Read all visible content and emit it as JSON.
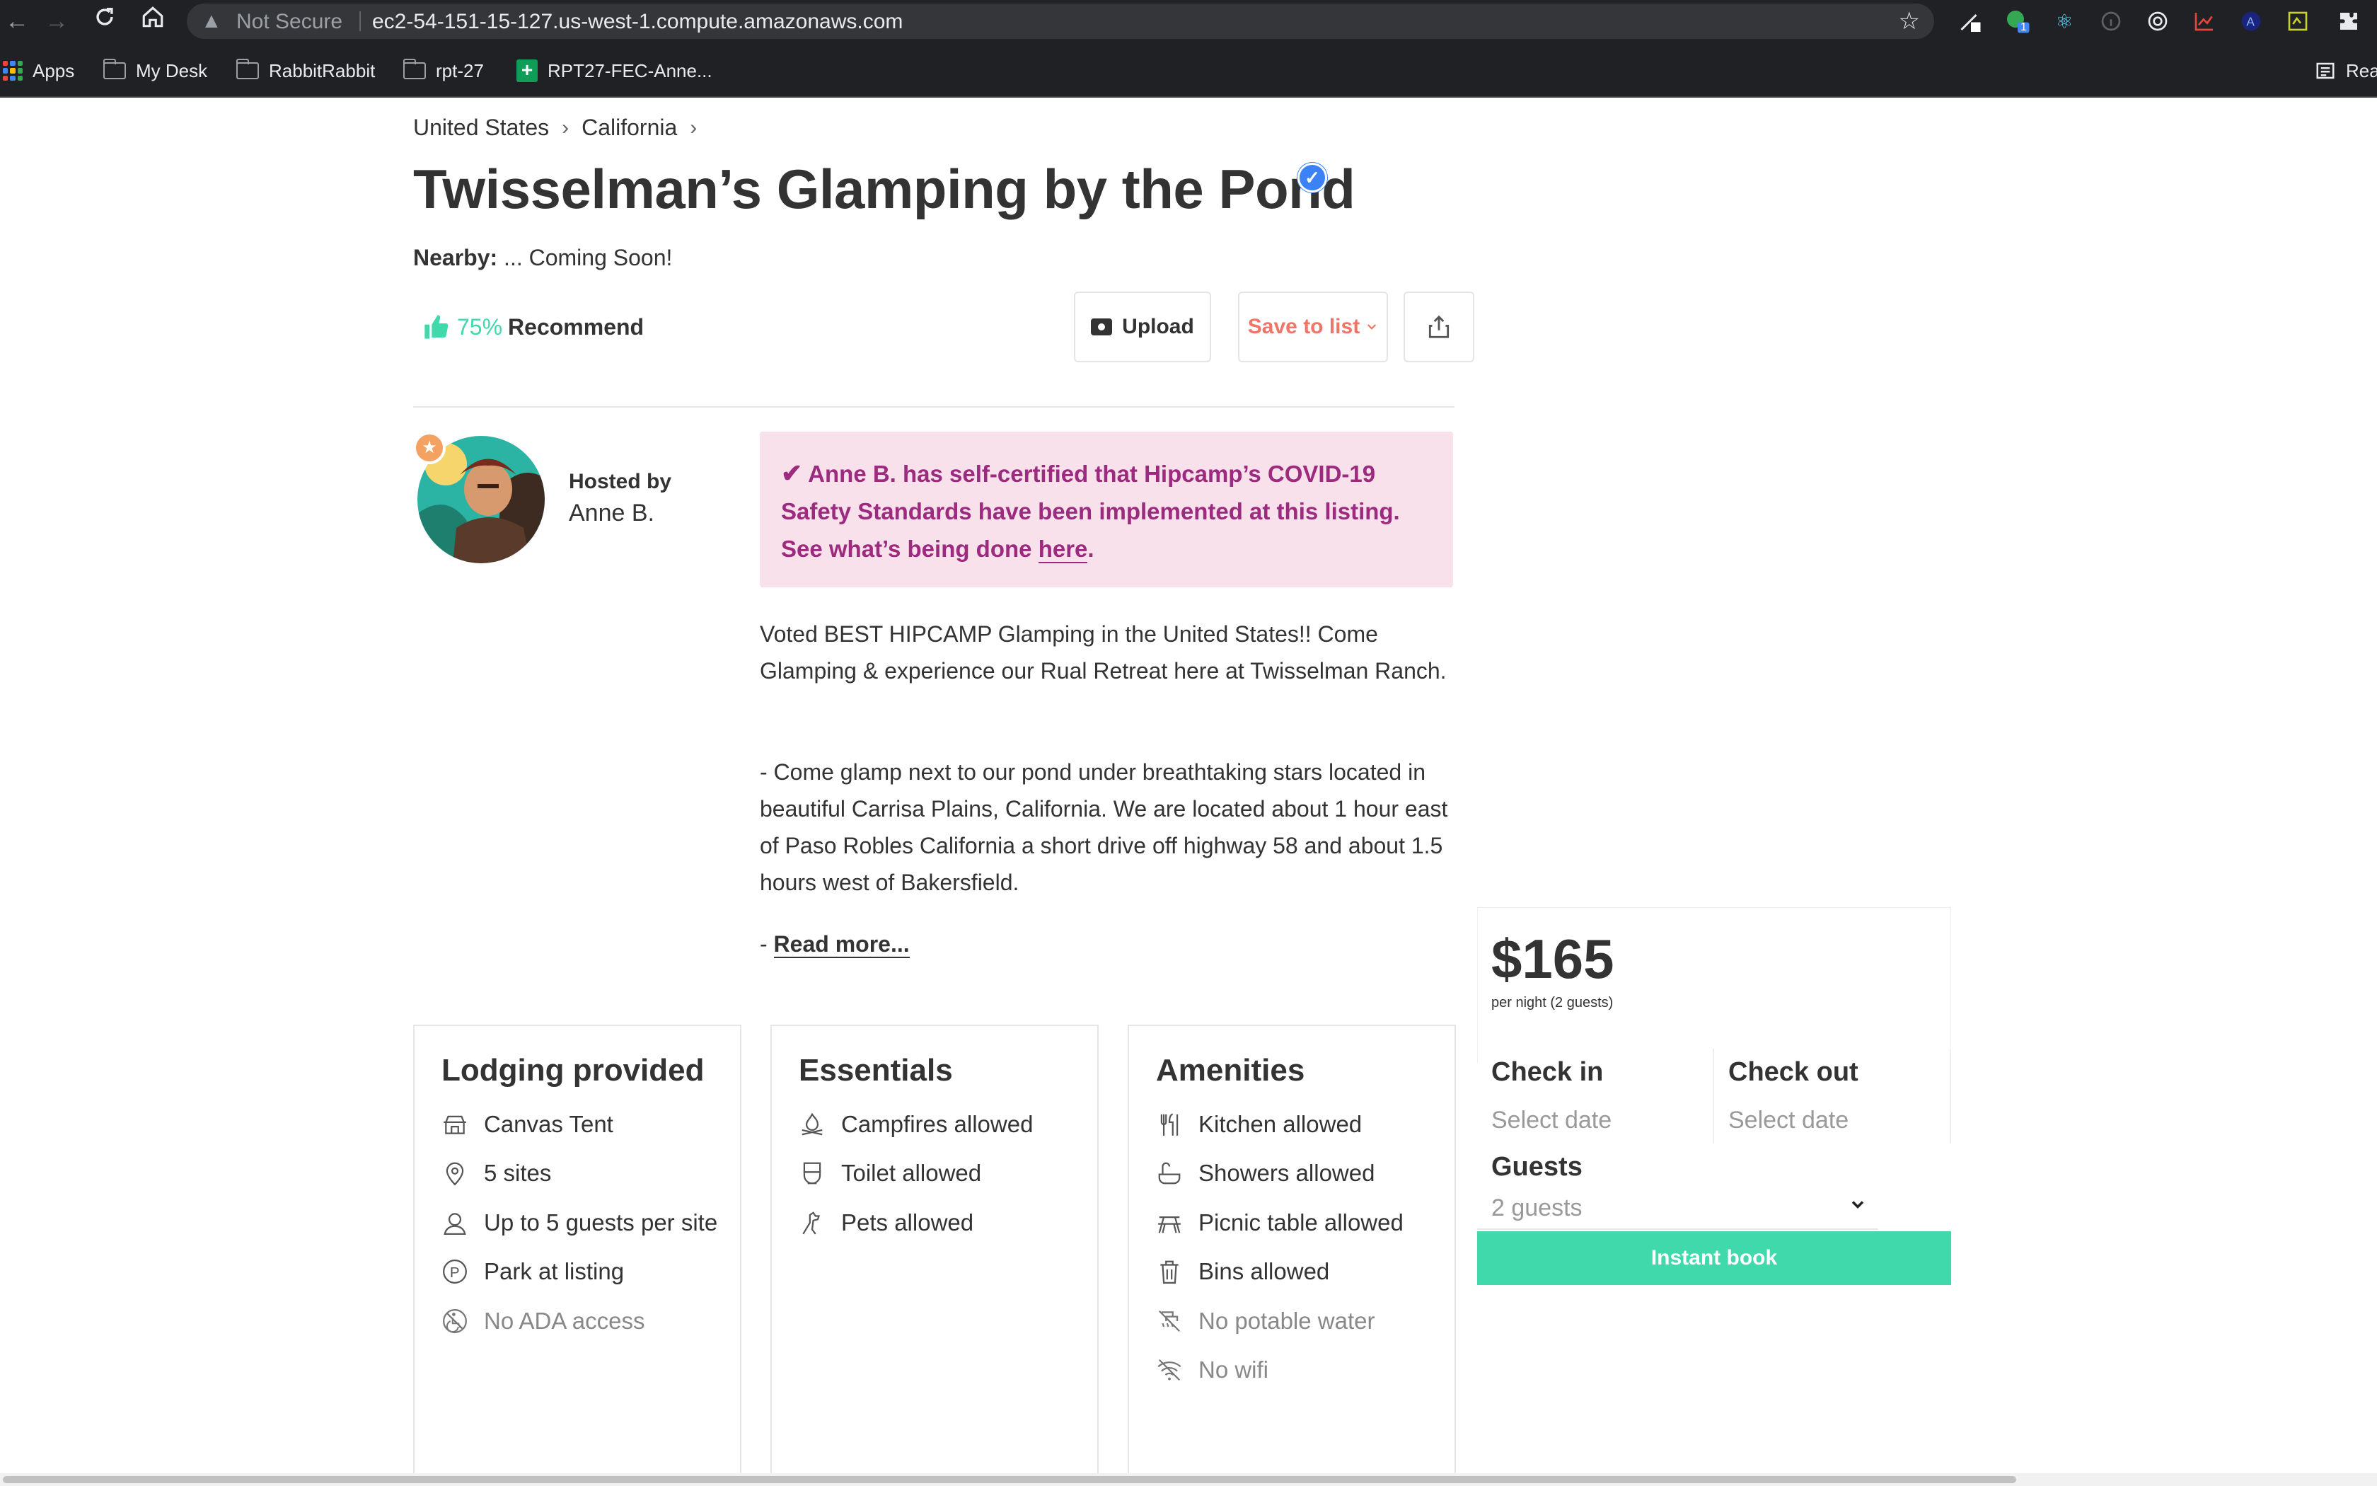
{
  "browser": {
    "security_text": "Not Secure",
    "url": "ec2-54-151-15-127.us-west-1.compute.amazonaws.com",
    "extension_badge": "1",
    "bookmarks": [
      {
        "label": "Apps",
        "icon": "apps-grid-icon"
      },
      {
        "label": "My Desk",
        "icon": "folder-icon"
      },
      {
        "label": "RabbitRabbit",
        "icon": "folder-icon"
      },
      {
        "label": "rpt-27",
        "icon": "folder-icon"
      },
      {
        "label": "RPT27-FEC-Anne...",
        "icon": "sheets-icon"
      }
    ],
    "reading_list_label": "Rea"
  },
  "breadcrumb": [
    "United States",
    "California"
  ],
  "listing": {
    "title": "Twisselman’s Glamping by the Pond",
    "nearby_label": "Nearby:",
    "nearby_value": " ... Coming Soon!",
    "recommend_pct": "75%",
    "recommend_label": "Recommend",
    "upload_label": "Upload",
    "save_label": "Save to list"
  },
  "host": {
    "hosted_by_label": "Hosted by",
    "name": "Anne B."
  },
  "covid_notice": {
    "text": "Anne B. has self-certified that Hipcamp’s COVID-19 Safety Standards have been implemented at this listing. See what’s being done ",
    "link": "here",
    "end": "."
  },
  "description": {
    "p1": "Voted BEST HIPCAMP Glamping in the United States!! Come Glamping & experience our Rual Retreat here at Twisselman Ranch.",
    "p2": "- Come glamp next to our pond under breathtaking stars located in beautiful Carrisa Plains, California. We are located about 1 hour east of Paso Robles California a short drive off highway 58 and about 1.5 hours west of Bakersfield.",
    "read_more_prefix": "- ",
    "read_more_label": "Read more..."
  },
  "cards": {
    "lodging": {
      "title": "Lodging provided",
      "items": [
        {
          "label": "Canvas Tent",
          "icon": "tent-icon",
          "available": true
        },
        {
          "label": "5 sites",
          "icon": "map-pin-icon",
          "available": true
        },
        {
          "label": "Up to 5 guests per site",
          "icon": "guests-icon",
          "available": true
        },
        {
          "label": "Park at listing",
          "icon": "parking-icon",
          "available": true
        },
        {
          "label": "No ADA access",
          "icon": "no-ada-icon",
          "available": false
        }
      ]
    },
    "essentials": {
      "title": "Essentials",
      "items": [
        {
          "label": "Campfires allowed",
          "icon": "campfire-icon",
          "available": true
        },
        {
          "label": "Toilet allowed",
          "icon": "toilet-icon",
          "available": true
        },
        {
          "label": "Pets allowed",
          "icon": "pet-icon",
          "available": true
        }
      ]
    },
    "amenities": {
      "title": "Amenities",
      "items": [
        {
          "label": "Kitchen allowed",
          "icon": "kitchen-icon",
          "available": true
        },
        {
          "label": "Showers allowed",
          "icon": "shower-icon",
          "available": true
        },
        {
          "label": "Picnic table allowed",
          "icon": "picnic-table-icon",
          "available": true
        },
        {
          "label": "Bins allowed",
          "icon": "bin-icon",
          "available": true
        },
        {
          "label": "No potable water",
          "icon": "no-water-icon",
          "available": false
        },
        {
          "label": "No wifi",
          "icon": "no-wifi-icon",
          "available": false
        }
      ]
    }
  },
  "booking": {
    "price": "$165",
    "price_sub": "per night (2 guests)",
    "check_in_label": "Check in",
    "check_in_value": "Select date",
    "check_out_label": "Check out",
    "check_out_value": "Select date",
    "guests_label": "Guests",
    "guests_value": "2 guests",
    "instant_book_label": "Instant book"
  },
  "colors": {
    "accent_green": "#40d9ac",
    "save_coral": "#f07468",
    "covid_bg": "#f8e1ea",
    "covid_text": "#9c2a7e",
    "verified_blue": "#3b82f6"
  }
}
